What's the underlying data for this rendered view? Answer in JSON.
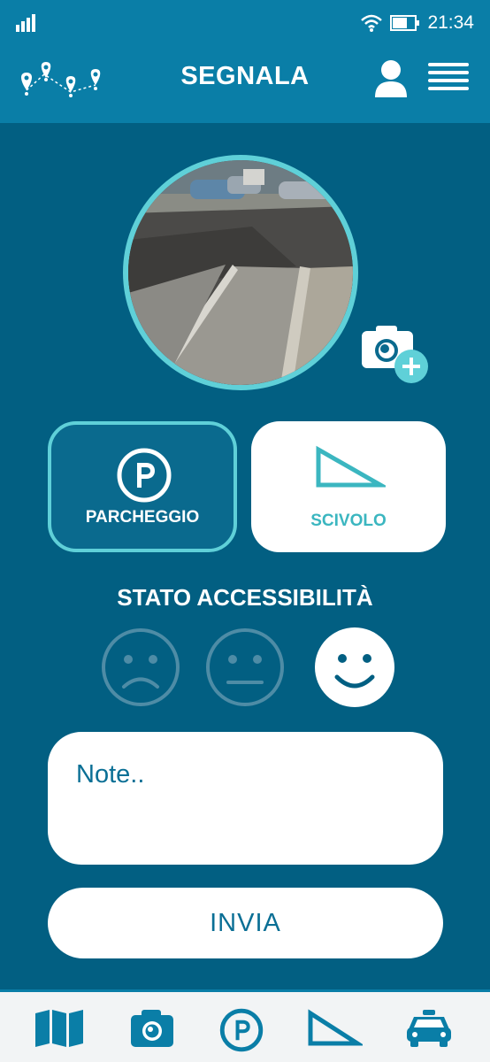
{
  "status_bar": {
    "time": "21:34",
    "icons": [
      "signal-icon",
      "wifi-icon",
      "battery-icon"
    ]
  },
  "header": {
    "title": "SEGNALA",
    "logo": "route-pins-logo",
    "icons": [
      "user-icon",
      "menu-icon"
    ]
  },
  "photo": {
    "alt": "ramp-photo",
    "add_icon": "camera-plus-icon"
  },
  "types": [
    {
      "label": "PARCHEGGIO",
      "icon": "parking-icon",
      "selected": false
    },
    {
      "label": "SCIVOLO",
      "icon": "ramp-icon",
      "selected": true
    }
  ],
  "accessibility": {
    "title": "STATO ACCESSIBILITÀ",
    "options": [
      "sad-face-icon",
      "neutral-face-icon",
      "happy-face-icon"
    ],
    "selected": "happy-face-icon"
  },
  "notes": {
    "placeholder": "Note.."
  },
  "submit": {
    "label": "INVIA"
  },
  "bottom_nav": [
    "map-icon",
    "camera-icon",
    "parking-icon",
    "ramp-icon",
    "car-icon"
  ],
  "colors": {
    "header": "#0a7ea7",
    "background": "#025f82",
    "accent": "#5fd0d8"
  }
}
